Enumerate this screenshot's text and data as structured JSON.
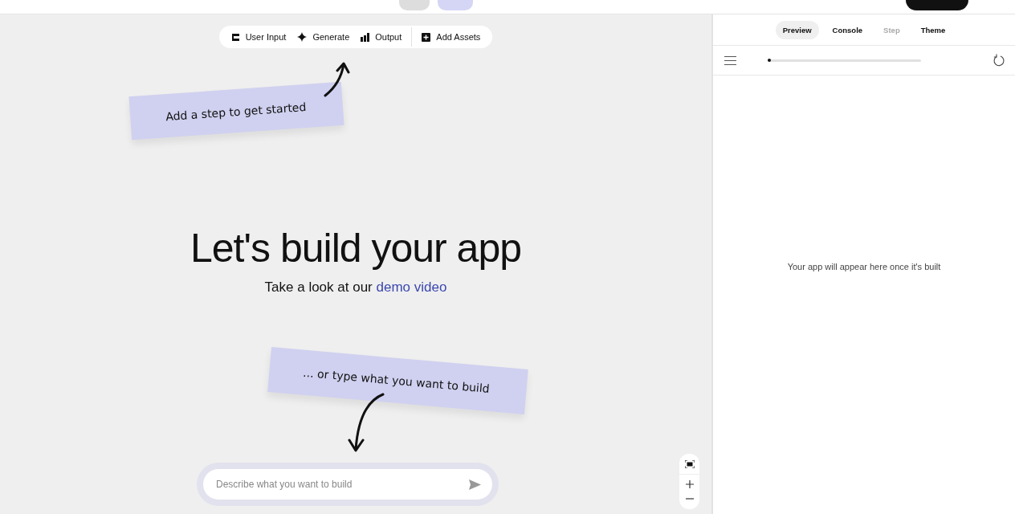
{
  "header": {
    "modes": [
      {
        "selected": false
      },
      {
        "selected": true
      }
    ]
  },
  "toolbar": {
    "items": [
      {
        "kind": "input",
        "label": "User Input"
      },
      {
        "kind": "generate",
        "label": "Generate"
      },
      {
        "kind": "output",
        "label": "Output"
      },
      {
        "kind": "assets",
        "label": "Add Assets"
      }
    ]
  },
  "notes": [
    {
      "text": "Add a step to get started"
    },
    {
      "text": "... or type what you want to build"
    }
  ],
  "hero": {
    "title": "Let's build your app",
    "subtitle": "Take a look at our",
    "link": "demo video"
  },
  "prompt": {
    "placeholder": "Describe what you want to build"
  },
  "preview": {
    "tabs": [
      {
        "label": "Preview",
        "selected": true,
        "disabled": false
      },
      {
        "label": "Console",
        "selected": false,
        "disabled": false
      },
      {
        "label": "Step",
        "selected": false,
        "disabled": true
      },
      {
        "label": "Theme",
        "selected": false,
        "disabled": false
      }
    ],
    "progress": {
      "level": 0.0
    },
    "empty_message": "Your app will appear here once it's built"
  }
}
